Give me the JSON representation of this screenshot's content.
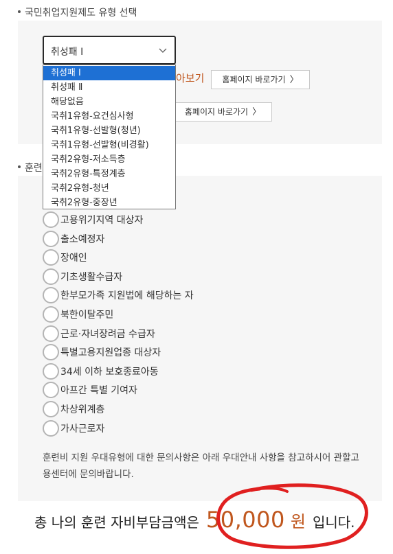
{
  "section1": {
    "title": "국민취업지원제도 유형 선택"
  },
  "select": {
    "value": "취성패 Ⅰ"
  },
  "dropdown": {
    "options": [
      "취성패 Ⅰ",
      "취성패 Ⅱ",
      "해당없음",
      "국취1유형-요건심사형",
      "국취1유형-선발형(청년)",
      "국취1유형-선발형(비경활)",
      "국취2유형-저소득층",
      "국취2유형-특정계층",
      "국취2유형-청년",
      "국취2유형-중장년"
    ],
    "selected_index": 0
  },
  "link": {
    "text": "아보기"
  },
  "buttons": {
    "homepage1": "홈페이지 바로가기",
    "homepage2": "홈페이지 바로가기",
    "arrow": "〉"
  },
  "section2": {
    "title": "훈련"
  },
  "radios": [
    "고용위기지역 대상자",
    "출소예정자",
    "장애인",
    "기초생활수급자",
    "한부모가족 지원법에 해당하는 자",
    "북한이탈주민",
    "근로·자녀장려금 수급자",
    "특별고용지원업종 대상자",
    "34세 이하 보호종료아동",
    "아프간 특별 기여자",
    "차상위계층",
    "가사근로자"
  ],
  "note": "훈련비 지원 우대유형에 대한 문의사항은 아래 우대안내 사항을 참고하시어 관할고용센터에 문의바랍니다.",
  "total": {
    "prefix": "총 나의 훈련 자비부담금액은",
    "amount": "50,000",
    "unit": "원",
    "suffix": "입니다."
  },
  "colors": {
    "accent": "#c0571e",
    "selected_option": "#1e70d4",
    "annotation_circle": "#e02020"
  }
}
